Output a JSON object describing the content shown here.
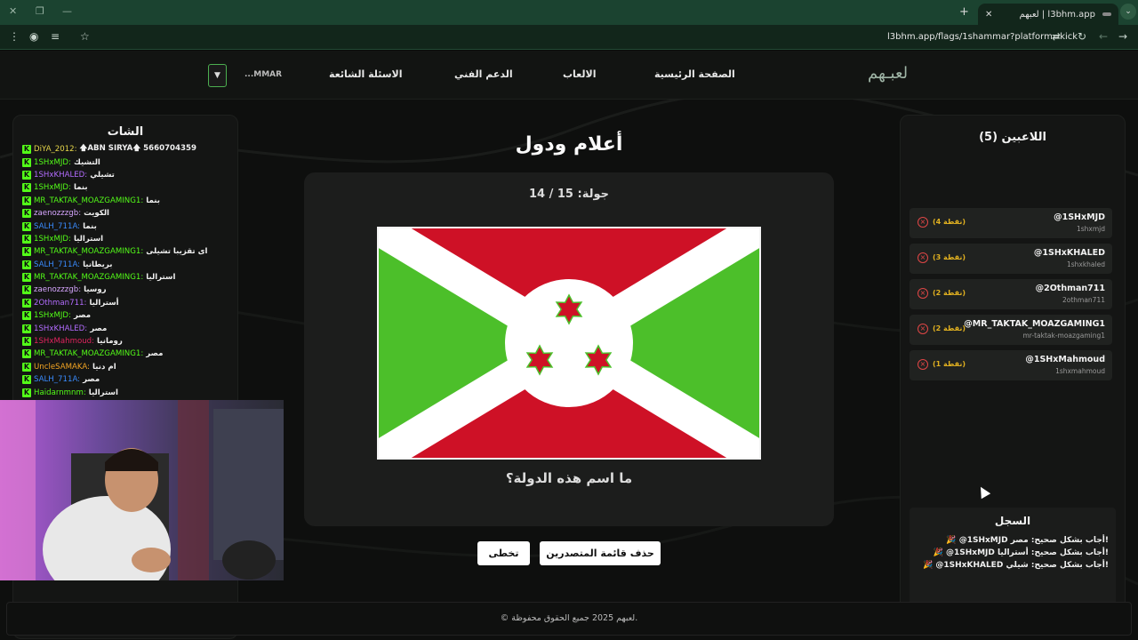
{
  "browser": {
    "tab_title": "لعبهم | l3bhm.app",
    "url": "l3bhm.app/flags/1shammar?platform=kick"
  },
  "nav": {
    "logo": "لعبـهم",
    "home": "الصفحة الرئيسية",
    "games": "الالعاب",
    "support": "الدعم الفني",
    "faq": "الاسئلة الشائعة",
    "user": "...MMAR"
  },
  "chat": {
    "title": "الشات",
    "messages": [
      {
        "user": "DiYA_2012:",
        "text": "🡅ABN SIRYA🡅 5660704359",
        "color": "#e6d64a"
      },
      {
        "user": "1SHxMJD:",
        "text": "التشيك",
        "color": "#53fc18"
      },
      {
        "user": "1SHxKHALED:",
        "text": "تشيلي",
        "color": "#b36cff"
      },
      {
        "user": "1SHxMJD:",
        "text": "بنما",
        "color": "#53fc18"
      },
      {
        "user": "MR_TAKTAK_MOAZGAMING1:",
        "text": "بنما",
        "color": "#53fc18"
      },
      {
        "user": "zaenozzzgb:",
        "text": "الكويت",
        "color": "#d7a6ff"
      },
      {
        "user": "SALH_711A:",
        "text": "بنما",
        "color": "#3a8cff"
      },
      {
        "user": "1SHxMJD:",
        "text": "استراليا",
        "color": "#53fc18"
      },
      {
        "user": "MR_TAKTAK_MOAZGAMING1:",
        "text": "اى تقزيبا تشيلى",
        "color": "#53fc18"
      },
      {
        "user": "SALH_711A:",
        "text": "بريطانيا",
        "color": "#3a8cff"
      },
      {
        "user": "MR_TAKTAK_MOAZGAMING1:",
        "text": "استراليا",
        "color": "#53fc18"
      },
      {
        "user": "zaenozzzgb:",
        "text": "روسيا",
        "color": "#d7a6ff"
      },
      {
        "user": "2Othman711:",
        "text": "أستراليا",
        "color": "#b36cff"
      },
      {
        "user": "1SHxMJD:",
        "text": "مصر",
        "color": "#53fc18"
      },
      {
        "user": "1SHxKHALED:",
        "text": "مصر",
        "color": "#b36cff"
      },
      {
        "user": "1SHxMahmoud:",
        "text": "رومانيا",
        "color": "#e0245e"
      },
      {
        "user": "MR_TAKTAK_MOAZGAMING1:",
        "text": "مصر",
        "color": "#53fc18"
      },
      {
        "user": "UncleSAMAKA:",
        "text": "ام دنيا",
        "color": "#f5a623"
      },
      {
        "user": "SALH_711A:",
        "text": "مصر",
        "color": "#3a8cff"
      },
      {
        "user": "Haidarnmnm:",
        "text": "استراليا",
        "color": "#53fc18"
      }
    ]
  },
  "game": {
    "title": "أعلام ودول",
    "round": "جولة: 15 / 14",
    "question": "ما اسم هذه الدولة؟",
    "clear_leaderboard": "حذف قائمة المتصدرين",
    "skip": "تخطى",
    "flag_colors": {
      "red": "#ce1126",
      "green": "#4cbf2a",
      "white": "#ffffff"
    }
  },
  "players": {
    "title": "اللاعبين (5)",
    "list": [
      {
        "handle": "@1SHxMJD",
        "sub": "1shxmjd",
        "points": "(4 نقطة)"
      },
      {
        "handle": "@1SHxKHALED",
        "sub": "1shxkhaled",
        "points": "(3 نقطة)"
      },
      {
        "handle": "@2Othman711",
        "sub": "2othman711",
        "points": "(2 نقطة)"
      },
      {
        "handle": "@MR_TAKTAK_MOAZGAMING1",
        "sub": "mr-taktak-moazgaming1",
        "points": "(2 نقطة)"
      },
      {
        "handle": "@1SHxMahmoud",
        "sub": "1shxmahmoud",
        "points": "(1 نقطة)"
      }
    ]
  },
  "log": {
    "title": "السجل",
    "entries": [
      "🎉 @1SHxMJD أجاب بشكل صحيح: مصر!",
      "🎉 @1SHxMJD أجاب بشكل صحيح: أستراليا!",
      "🎉 @1SHxKHALED أجاب بشكل صحيح: شيلي!"
    ]
  },
  "footer": "© لعبهم 2025 جميع الحقوق محفوظة."
}
